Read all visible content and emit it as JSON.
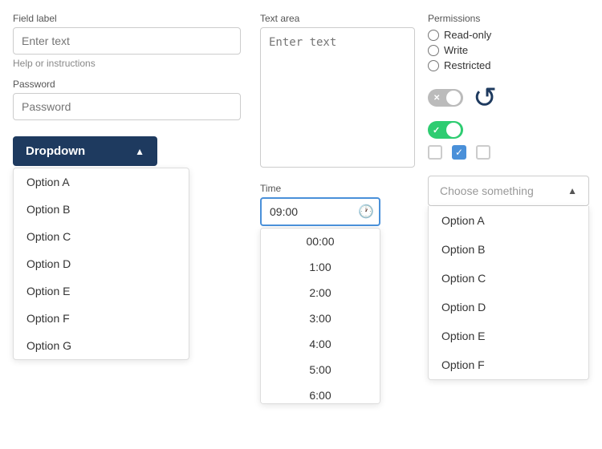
{
  "col1": {
    "field_label": "Field label",
    "field_input_placeholder": "Enter text",
    "help_text": "Help or instructions",
    "password_label": "Password",
    "password_placeholder": "Password",
    "dropdown_label": "Dropdown",
    "dropdown_items": [
      "Option A",
      "Option B",
      "Option C",
      "Option D",
      "Option E",
      "Option F",
      "Option G"
    ]
  },
  "col2": {
    "textarea_label": "Text area",
    "textarea_placeholder": "Enter text",
    "time_label": "Time",
    "time_value": "09:00",
    "time_options": [
      "00:00",
      "1:00",
      "2:00",
      "3:00",
      "4:00",
      "5:00",
      "6:00"
    ]
  },
  "col3": {
    "permissions_label": "Permissions",
    "radio_options": [
      "Read-only",
      "Write",
      "Restricted"
    ],
    "choose_placeholder": "Choose something",
    "choose_items": [
      "Option A",
      "Option B",
      "Option C",
      "Option D",
      "Option E",
      "Option F"
    ]
  }
}
